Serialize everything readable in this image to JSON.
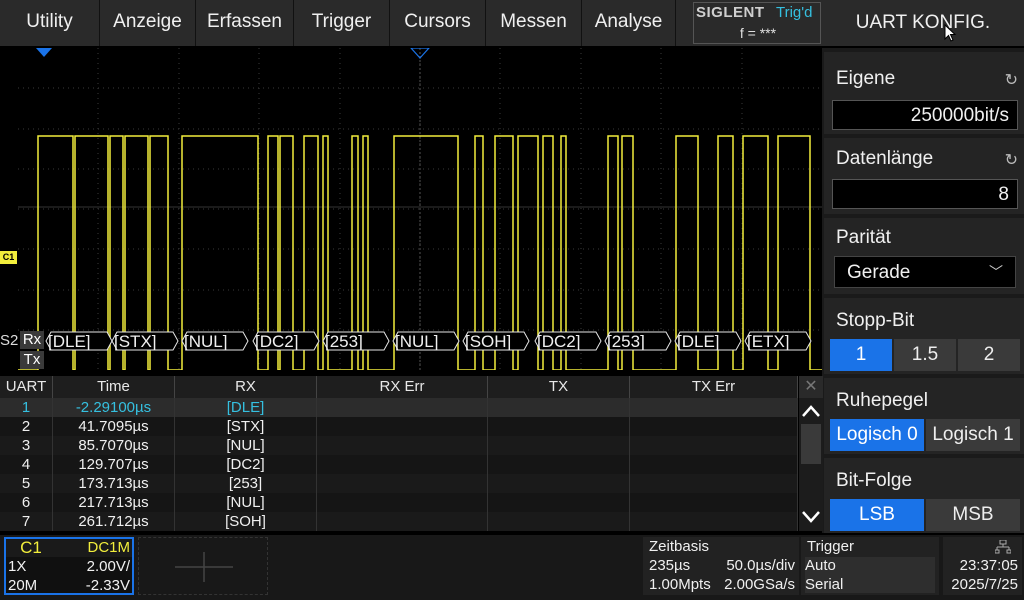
{
  "menu": [
    "Utility",
    "Anzeige",
    "Erfassen",
    "Trigger",
    "Cursors",
    "Messen",
    "Analyse"
  ],
  "brand": {
    "logo": "SIGLENT",
    "status": "Trig'd",
    "freq": "f = ***"
  },
  "panel": {
    "title": "UART KONFIG.",
    "baud_label": "Eigene",
    "baud_value": "250000bit/s",
    "datalen_label": "Datenlänge",
    "datalen_value": "8",
    "parity_label": "Parität",
    "parity_value": "Gerade",
    "stop_label": "Stopp-Bit",
    "stop_options": [
      "1",
      "1.5",
      "2"
    ],
    "idle_label": "Ruhepegel",
    "idle_options": [
      "Logisch 0",
      "Logisch 1"
    ],
    "bitorder_label": "Bit-Folge",
    "bitorder_options": [
      "LSB",
      "MSB"
    ]
  },
  "scope": {
    "channel_marker": "C1",
    "bus_label": "S2",
    "rx_label": "Rx",
    "tx_label": "Tx",
    "decode": [
      "[DLE]",
      "[STX]",
      "[NUL]",
      "[DC2]",
      "[253]",
      "[NUL]",
      "[SOH]",
      "[DC2]",
      "[253]",
      "[DLE]",
      "[ETX]"
    ]
  },
  "table": {
    "headers": [
      "UART",
      "Time",
      "RX",
      "RX Err",
      "TX",
      "TX Err"
    ],
    "rows": [
      [
        "1",
        "-2.29100µs",
        "[DLE]",
        "",
        "",
        ""
      ],
      [
        "2",
        "41.7095µs",
        "[STX]",
        "",
        "",
        ""
      ],
      [
        "3",
        "85.7070µs",
        "[NUL]",
        "",
        "",
        ""
      ],
      [
        "4",
        "129.707µs",
        "[DC2]",
        "",
        "",
        ""
      ],
      [
        "5",
        "173.713µs",
        "[253]",
        "",
        "",
        ""
      ],
      [
        "6",
        "217.713µs",
        "[NUL]",
        "",
        "",
        ""
      ],
      [
        "7",
        "261.712µs",
        "[SOH]",
        "",
        "",
        ""
      ]
    ]
  },
  "channel": {
    "name": "C1",
    "coupling": "DC1M",
    "probe": "1X",
    "scale": "2.00V/",
    "bw": "20M",
    "offset": "-2.33V"
  },
  "timebase": {
    "label": "Zeitbasis",
    "delay": "235µs",
    "scale": "50.0µs/div",
    "points": "1.00Mpts",
    "rate": "2.00GSa/s"
  },
  "trigger": {
    "label": "Trigger",
    "mode": "Auto",
    "type": "Serial"
  },
  "clock": {
    "time": "23:37:05",
    "date": "2025/7/25"
  },
  "colors": {
    "trace": "#f2ee3c",
    "accent": "#1a73e8",
    "highlight": "#35c0e0"
  }
}
